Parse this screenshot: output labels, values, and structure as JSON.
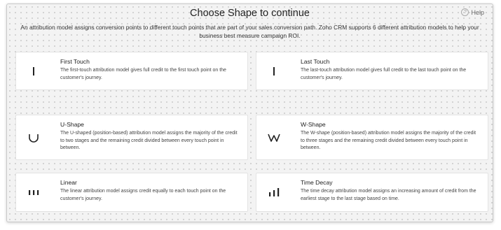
{
  "dialog": {
    "title": "Choose Shape to continue",
    "help_label": "Help",
    "help_glyph": "?",
    "intro": "An attribution model assigns conversion points to different touch points that are part of your sales conversion path. Zoho CRM supports 6 different attribution models to help your business best measure campaign ROI."
  },
  "models": [
    {
      "title": "First Touch",
      "icon": "single-bar-icon",
      "description": "The first-touch attribution model gives full credit to the first touch point on the customer's journey."
    },
    {
      "title": "Last Touch",
      "icon": "single-bar-icon",
      "description": "The last-touch attribution model gives full credit to the last touch point on the customer's journey."
    },
    {
      "title": "U-Shape",
      "icon": "u-shape-icon",
      "description": "The U-shaped (position-based) attribution model assigns the majority of the credit to two stages and the remaining credit divided between every touch point in between."
    },
    {
      "title": "W-Shape",
      "icon": "w-shape-icon",
      "description": "The W-shape (position-based) attribution model assigns the majority of the credit to three stages and the remaining credit divided between every touch point in between."
    },
    {
      "title": "Linear",
      "icon": "equal-bars-icon",
      "description": "The linear attribution model assigns credit equally to each touch point on the customer's journey."
    },
    {
      "title": "Time Decay",
      "icon": "increasing-bars-icon",
      "description": "The time decay attribution model assigns an increasing amount of credit from the earliest stage to the last stage based on time."
    }
  ]
}
